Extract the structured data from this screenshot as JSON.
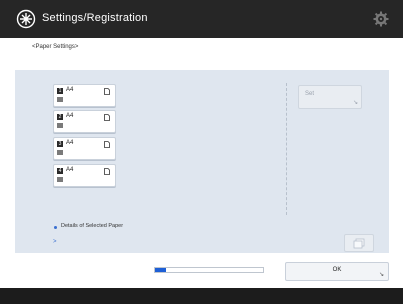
{
  "header": {
    "title": "Settings/Registration",
    "icon": "settings-registration-icon"
  },
  "breadcrumb": "<Paper Settings>",
  "trays": [
    {
      "num": "1",
      "size": "A4"
    },
    {
      "num": "2",
      "size": "A4"
    },
    {
      "num": "3",
      "size": "A4"
    },
    {
      "num": "4",
      "size": "A4"
    }
  ],
  "set_button": {
    "label": "Set"
  },
  "details": {
    "label": "Details of Selected Paper",
    "arrow": ">"
  },
  "progress": {
    "fraction": 0.1
  },
  "ok_button": {
    "label": "OK"
  },
  "colors": {
    "titlebar": "#262626",
    "panel": "#dfe6ef",
    "accent": "#1e5fd6"
  }
}
